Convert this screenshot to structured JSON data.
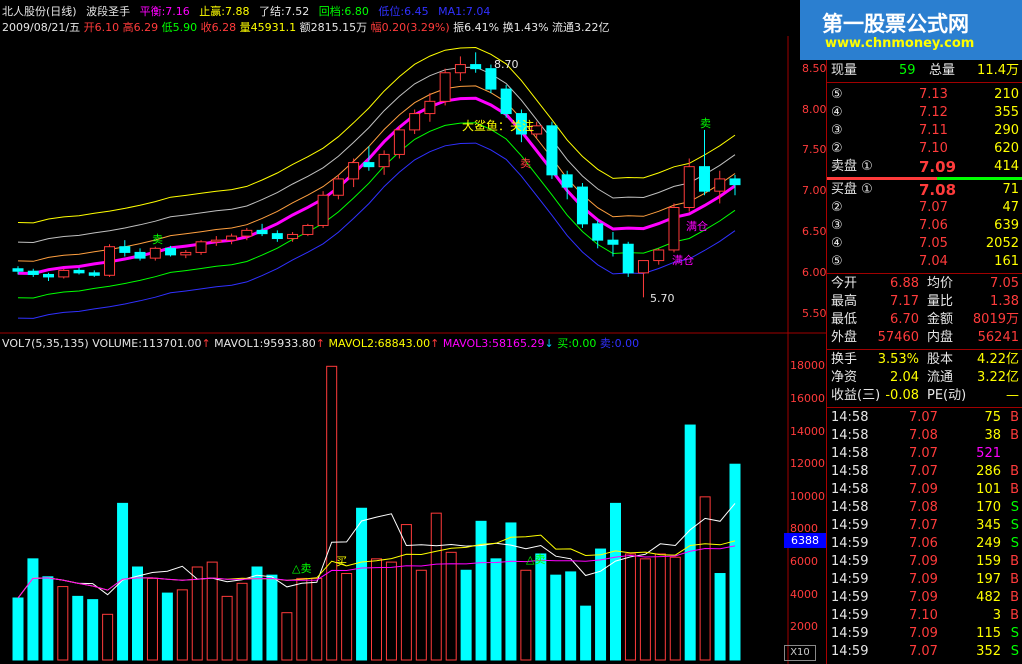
{
  "kline_header": {
    "stock": "北人股份(日线)",
    "indicator": "波段圣手",
    "pingheng": "平衡:7.16",
    "zhiying": "止赢:7.88",
    "liaojie": "了结:7.52",
    "huidang": "回档:6.80",
    "diwei": "低位:6.45",
    "ma1": "MA1:7.04"
  },
  "ohlc_line": {
    "date": "2009/08/21/五",
    "open": "开6.10",
    "high": "高6.29",
    "low": "低5.90",
    "close": "收6.28",
    "vol": "量45931.1",
    "amount": "额2815.15万",
    "change": "幅0.20(3.29%)",
    "amplitude": "振6.41%",
    "turnover": "换1.43%",
    "float": "流通3.22亿"
  },
  "chart_labels": {
    "peak": "8.70",
    "trough": "5.70",
    "big_fish": "大鲨鱼：关注",
    "full1": "满仓",
    "full2": "满仓",
    "sell_mark": "卖",
    "buy_mark": "买",
    "sell_tri": "△卖",
    "buy_circle": "买",
    "vol_marker": "6388",
    "x10": "X10",
    "corner": "60"
  },
  "price_axis": [
    "8.50",
    "8.00",
    "7.50",
    "7.00",
    "6.50",
    "6.00",
    "5.50"
  ],
  "vol_axis": [
    "18000",
    "16000",
    "14000",
    "12000",
    "10000",
    "8000",
    "6000",
    "4000",
    "2000"
  ],
  "vol_header": {
    "vol": "VOL7(5,35,135)",
    "volume": "VOLUME:113701.00",
    "mavol1": "MAVOL1:95933.80",
    "mavol2": "MAVOL2:68843.00",
    "mavol3": "MAVOL3:58165.29",
    "buy": "买:0.00",
    "sell": "卖:0.00"
  },
  "watermark": {
    "line1": "第一股票公式网",
    "line2": "www.chnmoney.com"
  },
  "quote": {
    "xianliang_label": "现量",
    "xianliang": "59",
    "zongliang_label": "总量",
    "zongliang": "11.4万",
    "asks": [
      {
        "lvl": "⑤",
        "price": "7.13",
        "vol": "210"
      },
      {
        "lvl": "④",
        "price": "7.12",
        "vol": "355"
      },
      {
        "lvl": "③",
        "price": "7.11",
        "vol": "290"
      },
      {
        "lvl": "②",
        "price": "7.10",
        "vol": "620"
      },
      {
        "lvl": "卖盘 ①",
        "price": "7.09",
        "vol": "414"
      }
    ],
    "bids": [
      {
        "lvl": "买盘 ①",
        "price": "7.08",
        "vol": "71"
      },
      {
        "lvl": "②",
        "price": "7.07",
        "vol": "47"
      },
      {
        "lvl": "③",
        "price": "7.06",
        "vol": "639"
      },
      {
        "lvl": "④",
        "price": "7.05",
        "vol": "2052"
      },
      {
        "lvl": "⑤",
        "price": "7.04",
        "vol": "161"
      }
    ],
    "stats": [
      {
        "l1": "今开",
        "v1": "6.88",
        "l2": "均价",
        "v2": "7.05"
      },
      {
        "l1": "最高",
        "v1": "7.17",
        "l2": "量比",
        "v2": "1.38"
      },
      {
        "l1": "最低",
        "v1": "6.70",
        "l2": "金额",
        "v2": "8019万"
      },
      {
        "l1": "外盘",
        "v1": "57460",
        "l2": "内盘",
        "v2": "56241"
      }
    ],
    "stats2": [
      {
        "l1": "换手",
        "v1": "3.53%",
        "l2": "股本",
        "v2": "4.22亿"
      },
      {
        "l1": "净资",
        "v1": "2.04",
        "l2": "流通",
        "v2": "3.22亿"
      },
      {
        "l1": "收益(三)",
        "v1": "-0.08",
        "l2": "PE(动)",
        "v2": "—"
      }
    ],
    "ticks": [
      {
        "t": "14:58",
        "p": "7.07",
        "v": "75",
        "s": "B"
      },
      {
        "t": "14:58",
        "p": "7.08",
        "v": "38",
        "s": "B"
      },
      {
        "t": "14:58",
        "p": "7.07",
        "v": "521",
        "s": ""
      },
      {
        "t": "14:58",
        "p": "7.07",
        "v": "286",
        "s": "B"
      },
      {
        "t": "14:58",
        "p": "7.09",
        "v": "101",
        "s": "B"
      },
      {
        "t": "14:58",
        "p": "7.08",
        "v": "170",
        "s": "S"
      },
      {
        "t": "14:59",
        "p": "7.07",
        "v": "345",
        "s": "S"
      },
      {
        "t": "14:59",
        "p": "7.06",
        "v": "249",
        "s": "S"
      },
      {
        "t": "14:59",
        "p": "7.09",
        "v": "159",
        "s": "B"
      },
      {
        "t": "14:59",
        "p": "7.09",
        "v": "197",
        "s": "B"
      },
      {
        "t": "14:59",
        "p": "7.09",
        "v": "482",
        "s": "B"
      },
      {
        "t": "14:59",
        "p": "7.10",
        "v": "3",
        "s": "B"
      },
      {
        "t": "14:59",
        "p": "7.09",
        "v": "115",
        "s": "S"
      },
      {
        "t": "14:59",
        "p": "7.07",
        "v": "352",
        "s": "S"
      }
    ]
  },
  "chart_data": {
    "type": "candlestick",
    "price_ylim": [
      5.3,
      8.9
    ],
    "candles": [
      [
        6.05,
        6.08,
        5.98,
        6.02
      ],
      [
        6.02,
        6.05,
        5.95,
        5.98
      ],
      [
        5.98,
        6.0,
        5.9,
        5.95
      ],
      [
        5.95,
        6.05,
        5.93,
        6.03
      ],
      [
        6.03,
        6.06,
        5.98,
        6.0
      ],
      [
        6.0,
        6.03,
        5.95,
        5.97
      ],
      [
        5.97,
        6.35,
        5.95,
        6.32
      ],
      [
        6.32,
        6.4,
        6.2,
        6.25
      ],
      [
        6.25,
        6.3,
        6.15,
        6.18
      ],
      [
        6.18,
        6.32,
        6.15,
        6.3
      ],
      [
        6.3,
        6.33,
        6.2,
        6.22
      ],
      [
        6.22,
        6.28,
        6.18,
        6.25
      ],
      [
        6.25,
        6.4,
        6.22,
        6.38
      ],
      [
        6.38,
        6.45,
        6.33,
        6.4
      ],
      [
        6.4,
        6.48,
        6.35,
        6.45
      ],
      [
        6.45,
        6.55,
        6.4,
        6.52
      ],
      [
        6.52,
        6.6,
        6.45,
        6.48
      ],
      [
        6.48,
        6.52,
        6.38,
        6.42
      ],
      [
        6.42,
        6.5,
        6.38,
        6.47
      ],
      [
        6.47,
        6.6,
        6.45,
        6.58
      ],
      [
        6.58,
        7.0,
        6.55,
        6.95
      ],
      [
        6.95,
        7.2,
        6.9,
        7.15
      ],
      [
        7.15,
        7.4,
        7.05,
        7.35
      ],
      [
        7.35,
        7.55,
        7.25,
        7.3
      ],
      [
        7.3,
        7.5,
        7.2,
        7.45
      ],
      [
        7.45,
        7.8,
        7.4,
        7.75
      ],
      [
        7.75,
        8.0,
        7.7,
        7.95
      ],
      [
        7.95,
        8.2,
        7.85,
        8.1
      ],
      [
        8.1,
        8.5,
        8.05,
        8.45
      ],
      [
        8.45,
        8.65,
        8.35,
        8.55
      ],
      [
        8.55,
        8.7,
        8.45,
        8.5
      ],
      [
        8.5,
        8.55,
        8.2,
        8.25
      ],
      [
        8.25,
        8.3,
        7.9,
        7.95
      ],
      [
        7.95,
        8.0,
        7.6,
        7.7
      ],
      [
        7.7,
        7.85,
        7.65,
        7.8
      ],
      [
        7.8,
        7.85,
        7.15,
        7.2
      ],
      [
        7.2,
        7.25,
        6.9,
        7.05
      ],
      [
        7.05,
        7.1,
        6.55,
        6.6
      ],
      [
        6.6,
        6.65,
        6.3,
        6.4
      ],
      [
        6.4,
        6.5,
        6.2,
        6.35
      ],
      [
        6.35,
        6.38,
        5.95,
        6.0
      ],
      [
        6.0,
        6.1,
        5.7,
        6.15
      ],
      [
        6.15,
        6.3,
        6.1,
        6.28
      ],
      [
        6.28,
        6.85,
        6.25,
        6.8
      ],
      [
        6.8,
        7.4,
        6.75,
        7.3
      ],
      [
        7.3,
        7.75,
        6.95,
        7.0
      ],
      [
        7.0,
        7.25,
        6.85,
        7.15
      ],
      [
        7.15,
        7.2,
        6.95,
        7.08
      ]
    ],
    "volume": [
      3800,
      6200,
      5100,
      4500,
      3900,
      3700,
      2800,
      9600,
      5700,
      5000,
      4100,
      4300,
      5700,
      6000,
      3900,
      4700,
      5700,
      5200,
      2900,
      5000,
      5000,
      18000,
      5300,
      9300,
      6200,
      6000,
      8300,
      5500,
      9000,
      6600,
      5500,
      8500,
      6200,
      8400,
      5500,
      6500,
      5200,
      5400,
      3300,
      6800,
      9600,
      6500,
      6200,
      6500,
      6300,
      14400,
      10000,
      5300,
      12000
    ],
    "vol_ylim": [
      0,
      19000
    ]
  }
}
